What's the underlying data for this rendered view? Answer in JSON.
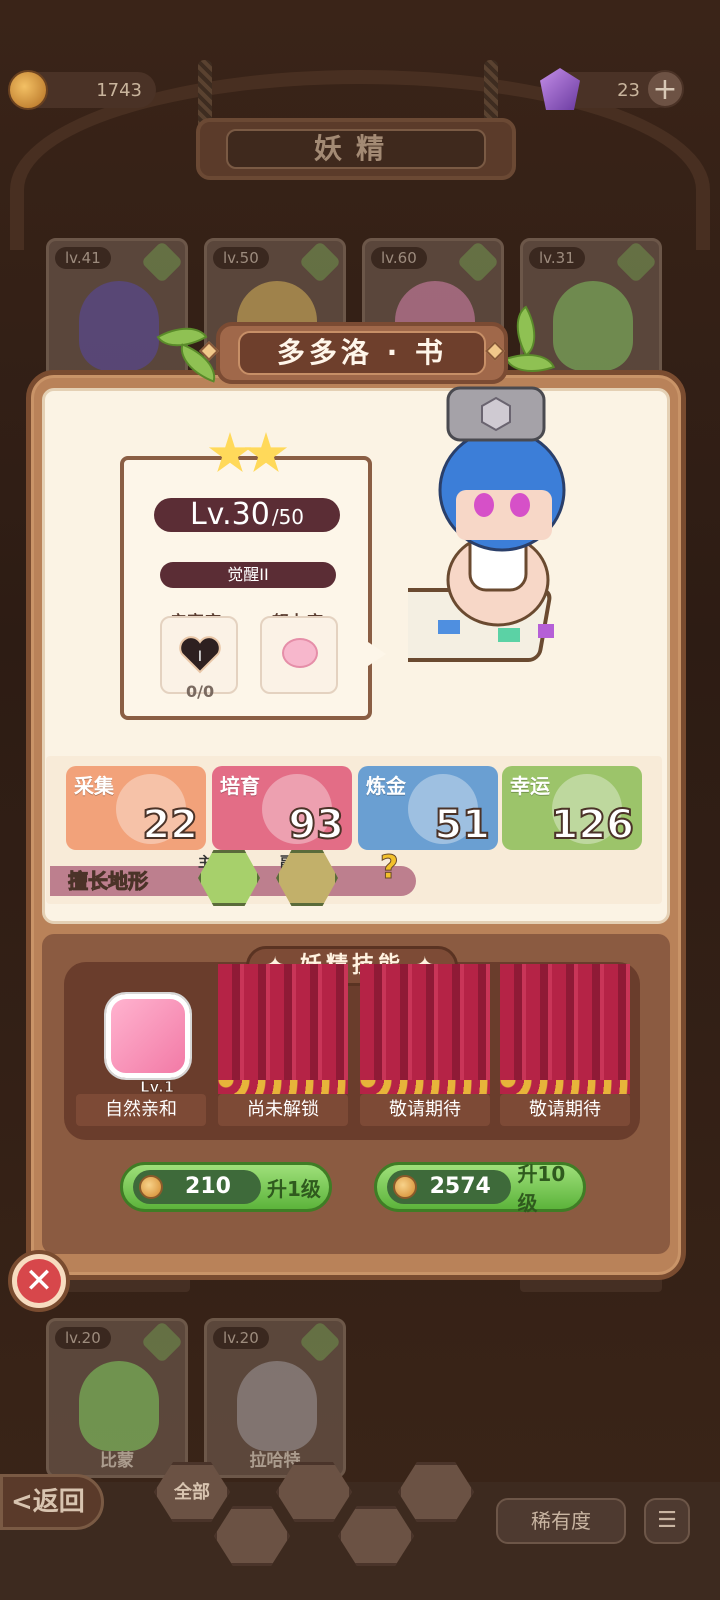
{
  "currency": {
    "coins": "1743",
    "gems": "23",
    "plus": "+"
  },
  "page_title": "妖精",
  "bg_cards_top": [
    {
      "level": "lv.41"
    },
    {
      "level": "lv.50"
    },
    {
      "level": "lv.60"
    },
    {
      "level": "lv.31"
    }
  ],
  "bg_cards_bottom": [
    {
      "level": "lv.20",
      "name": "比蒙"
    },
    {
      "level": "lv.20",
      "name": "拉哈特"
    }
  ],
  "fairy": {
    "name": "多多洛 · 书",
    "stars": 2,
    "level": "Lv.30",
    "level_max": "/50",
    "awaken": "觉醒II",
    "intimacy_label": "亲密度",
    "intimacy_value": "I",
    "intimacy_progress": "0/0",
    "effort_label": "努力度"
  },
  "attributes": [
    {
      "label": "采集",
      "value": "22",
      "color": "#f2a27a"
    },
    {
      "label": "培育",
      "value": "93",
      "color": "#e36d86"
    },
    {
      "label": "炼金",
      "value": "51",
      "color": "#6a9fd2"
    },
    {
      "label": "幸运",
      "value": "126",
      "color": "#9cc46a"
    }
  ],
  "terrain": {
    "label": "擅长地形",
    "main_tag": "主",
    "sub_tag": "副",
    "unknown": "?"
  },
  "skills": {
    "title": "✦ 妖精技能 ✦",
    "slots": [
      {
        "label": "自然亲和",
        "level": "Lv.1"
      },
      {
        "label": "尚未解锁"
      },
      {
        "label": "敬请期待"
      },
      {
        "label": "敬请期待"
      }
    ]
  },
  "upgrade": {
    "one": {
      "cost": "210",
      "label": "升1级"
    },
    "ten": {
      "cost": "2574",
      "label": "升10级"
    }
  },
  "close": "✕",
  "bottom": {
    "back": "<返回",
    "all": "全部",
    "rarity": "稀有度",
    "sort": "☰"
  }
}
